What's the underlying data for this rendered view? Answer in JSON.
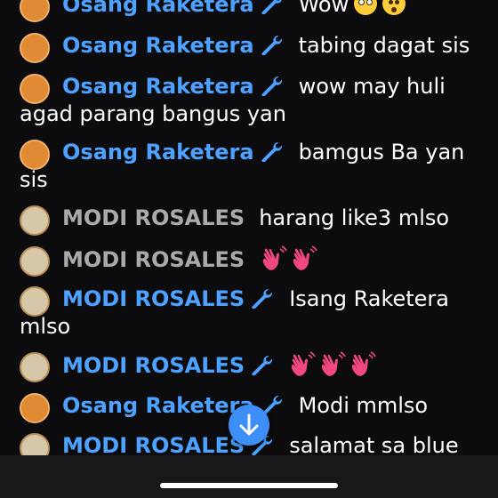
{
  "messages": [
    {
      "author": "Osang Raketera",
      "text": "Wow",
      "emoji": [
        "flushed-face-emoji",
        "frowning-open-mouth-emoji"
      ]
    },
    {
      "author": "Osang Raketera",
      "text": "tabing dagat sis"
    },
    {
      "author": "Osang Raketera",
      "text": "wow may huli agad parang bangus yan"
    },
    {
      "author": "Osang Raketera",
      "text": "bamgus Ba yan sis"
    },
    {
      "author": "MODI ROSALES",
      "text": "harang like3 mlso"
    },
    {
      "author": "MODI ROSALES",
      "text": "",
      "emoji": [
        "waving-hand-emoji",
        "waving-hand-emoji"
      ]
    },
    {
      "author": "MODI ROSALES",
      "text": "Isang Raketera mlso"
    },
    {
      "author": "MODI ROSALES",
      "text": "",
      "emoji": [
        "waving-hand-emoji",
        "waving-hand-emoji",
        "waving-hand-emoji"
      ]
    },
    {
      "author": "Osang Raketera",
      "text": "Modi mmlso"
    },
    {
      "author": "MODI ROSALES",
      "text": "salamat sa blue"
    }
  ],
  "icons": {
    "moderator": "wrench-icon",
    "scroll_down": "arrow-down-icon"
  },
  "colors": {
    "background": "#0c0c0f",
    "moderator_name": "#4ea2ff",
    "regular_name": "#a9a9ae",
    "message_text": "#ffffff",
    "scroll_button": "#3d8ff7"
  }
}
